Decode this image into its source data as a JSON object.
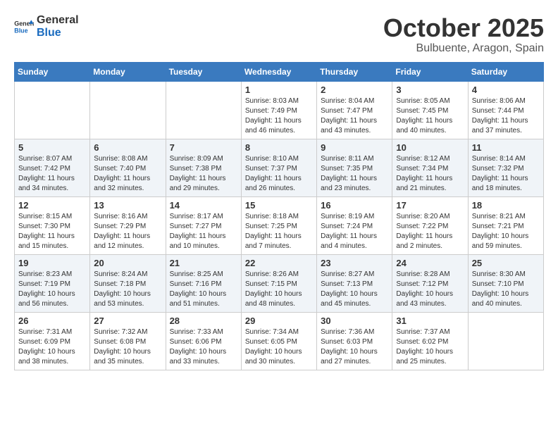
{
  "logo": {
    "text_general": "General",
    "text_blue": "Blue"
  },
  "calendar": {
    "title": "October 2025",
    "subtitle": "Bulbuente, Aragon, Spain"
  },
  "weekdays": [
    "Sunday",
    "Monday",
    "Tuesday",
    "Wednesday",
    "Thursday",
    "Friday",
    "Saturday"
  ],
  "weeks": [
    [
      {
        "day": "",
        "info": ""
      },
      {
        "day": "",
        "info": ""
      },
      {
        "day": "",
        "info": ""
      },
      {
        "day": "1",
        "info": "Sunrise: 8:03 AM\nSunset: 7:49 PM\nDaylight: 11 hours\nand 46 minutes."
      },
      {
        "day": "2",
        "info": "Sunrise: 8:04 AM\nSunset: 7:47 PM\nDaylight: 11 hours\nand 43 minutes."
      },
      {
        "day": "3",
        "info": "Sunrise: 8:05 AM\nSunset: 7:45 PM\nDaylight: 11 hours\nand 40 minutes."
      },
      {
        "day": "4",
        "info": "Sunrise: 8:06 AM\nSunset: 7:44 PM\nDaylight: 11 hours\nand 37 minutes."
      }
    ],
    [
      {
        "day": "5",
        "info": "Sunrise: 8:07 AM\nSunset: 7:42 PM\nDaylight: 11 hours\nand 34 minutes."
      },
      {
        "day": "6",
        "info": "Sunrise: 8:08 AM\nSunset: 7:40 PM\nDaylight: 11 hours\nand 32 minutes."
      },
      {
        "day": "7",
        "info": "Sunrise: 8:09 AM\nSunset: 7:38 PM\nDaylight: 11 hours\nand 29 minutes."
      },
      {
        "day": "8",
        "info": "Sunrise: 8:10 AM\nSunset: 7:37 PM\nDaylight: 11 hours\nand 26 minutes."
      },
      {
        "day": "9",
        "info": "Sunrise: 8:11 AM\nSunset: 7:35 PM\nDaylight: 11 hours\nand 23 minutes."
      },
      {
        "day": "10",
        "info": "Sunrise: 8:12 AM\nSunset: 7:34 PM\nDaylight: 11 hours\nand 21 minutes."
      },
      {
        "day": "11",
        "info": "Sunrise: 8:14 AM\nSunset: 7:32 PM\nDaylight: 11 hours\nand 18 minutes."
      }
    ],
    [
      {
        "day": "12",
        "info": "Sunrise: 8:15 AM\nSunset: 7:30 PM\nDaylight: 11 hours\nand 15 minutes."
      },
      {
        "day": "13",
        "info": "Sunrise: 8:16 AM\nSunset: 7:29 PM\nDaylight: 11 hours\nand 12 minutes."
      },
      {
        "day": "14",
        "info": "Sunrise: 8:17 AM\nSunset: 7:27 PM\nDaylight: 11 hours\nand 10 minutes."
      },
      {
        "day": "15",
        "info": "Sunrise: 8:18 AM\nSunset: 7:25 PM\nDaylight: 11 hours\nand 7 minutes."
      },
      {
        "day": "16",
        "info": "Sunrise: 8:19 AM\nSunset: 7:24 PM\nDaylight: 11 hours\nand 4 minutes."
      },
      {
        "day": "17",
        "info": "Sunrise: 8:20 AM\nSunset: 7:22 PM\nDaylight: 11 hours\nand 2 minutes."
      },
      {
        "day": "18",
        "info": "Sunrise: 8:21 AM\nSunset: 7:21 PM\nDaylight: 10 hours\nand 59 minutes."
      }
    ],
    [
      {
        "day": "19",
        "info": "Sunrise: 8:23 AM\nSunset: 7:19 PM\nDaylight: 10 hours\nand 56 minutes."
      },
      {
        "day": "20",
        "info": "Sunrise: 8:24 AM\nSunset: 7:18 PM\nDaylight: 10 hours\nand 53 minutes."
      },
      {
        "day": "21",
        "info": "Sunrise: 8:25 AM\nSunset: 7:16 PM\nDaylight: 10 hours\nand 51 minutes."
      },
      {
        "day": "22",
        "info": "Sunrise: 8:26 AM\nSunset: 7:15 PM\nDaylight: 10 hours\nand 48 minutes."
      },
      {
        "day": "23",
        "info": "Sunrise: 8:27 AM\nSunset: 7:13 PM\nDaylight: 10 hours\nand 45 minutes."
      },
      {
        "day": "24",
        "info": "Sunrise: 8:28 AM\nSunset: 7:12 PM\nDaylight: 10 hours\nand 43 minutes."
      },
      {
        "day": "25",
        "info": "Sunrise: 8:30 AM\nSunset: 7:10 PM\nDaylight: 10 hours\nand 40 minutes."
      }
    ],
    [
      {
        "day": "26",
        "info": "Sunrise: 7:31 AM\nSunset: 6:09 PM\nDaylight: 10 hours\nand 38 minutes."
      },
      {
        "day": "27",
        "info": "Sunrise: 7:32 AM\nSunset: 6:08 PM\nDaylight: 10 hours\nand 35 minutes."
      },
      {
        "day": "28",
        "info": "Sunrise: 7:33 AM\nSunset: 6:06 PM\nDaylight: 10 hours\nand 33 minutes."
      },
      {
        "day": "29",
        "info": "Sunrise: 7:34 AM\nSunset: 6:05 PM\nDaylight: 10 hours\nand 30 minutes."
      },
      {
        "day": "30",
        "info": "Sunrise: 7:36 AM\nSunset: 6:03 PM\nDaylight: 10 hours\nand 27 minutes."
      },
      {
        "day": "31",
        "info": "Sunrise: 7:37 AM\nSunset: 6:02 PM\nDaylight: 10 hours\nand 25 minutes."
      },
      {
        "day": "",
        "info": ""
      }
    ]
  ]
}
